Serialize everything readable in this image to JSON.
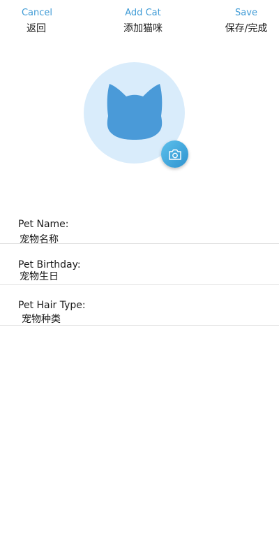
{
  "nav": {
    "cancel_en": "Cancel",
    "cancel_cn": "返回",
    "title_en": "Add Cat",
    "title_cn": "添加猫咪",
    "save_en": "Save",
    "save_cn": "保存/完成"
  },
  "avatar": {
    "placeholder_icon": "cat-head-icon",
    "camera_icon": "camera-icon"
  },
  "form": {
    "name_label": "Pet Name:",
    "name_value": "宠物名称",
    "birthday_label": "Pet Birthday:",
    "birthday_value": "宠物生日",
    "hair_label": "Pet Hair Type:",
    "hair_value": "宠物种类"
  },
  "colors": {
    "accent": "#3f9bd6",
    "avatar_bg": "#d9ecfb",
    "cat_silhouette": "#4a9ad8",
    "divider": "#e2e2e2"
  }
}
